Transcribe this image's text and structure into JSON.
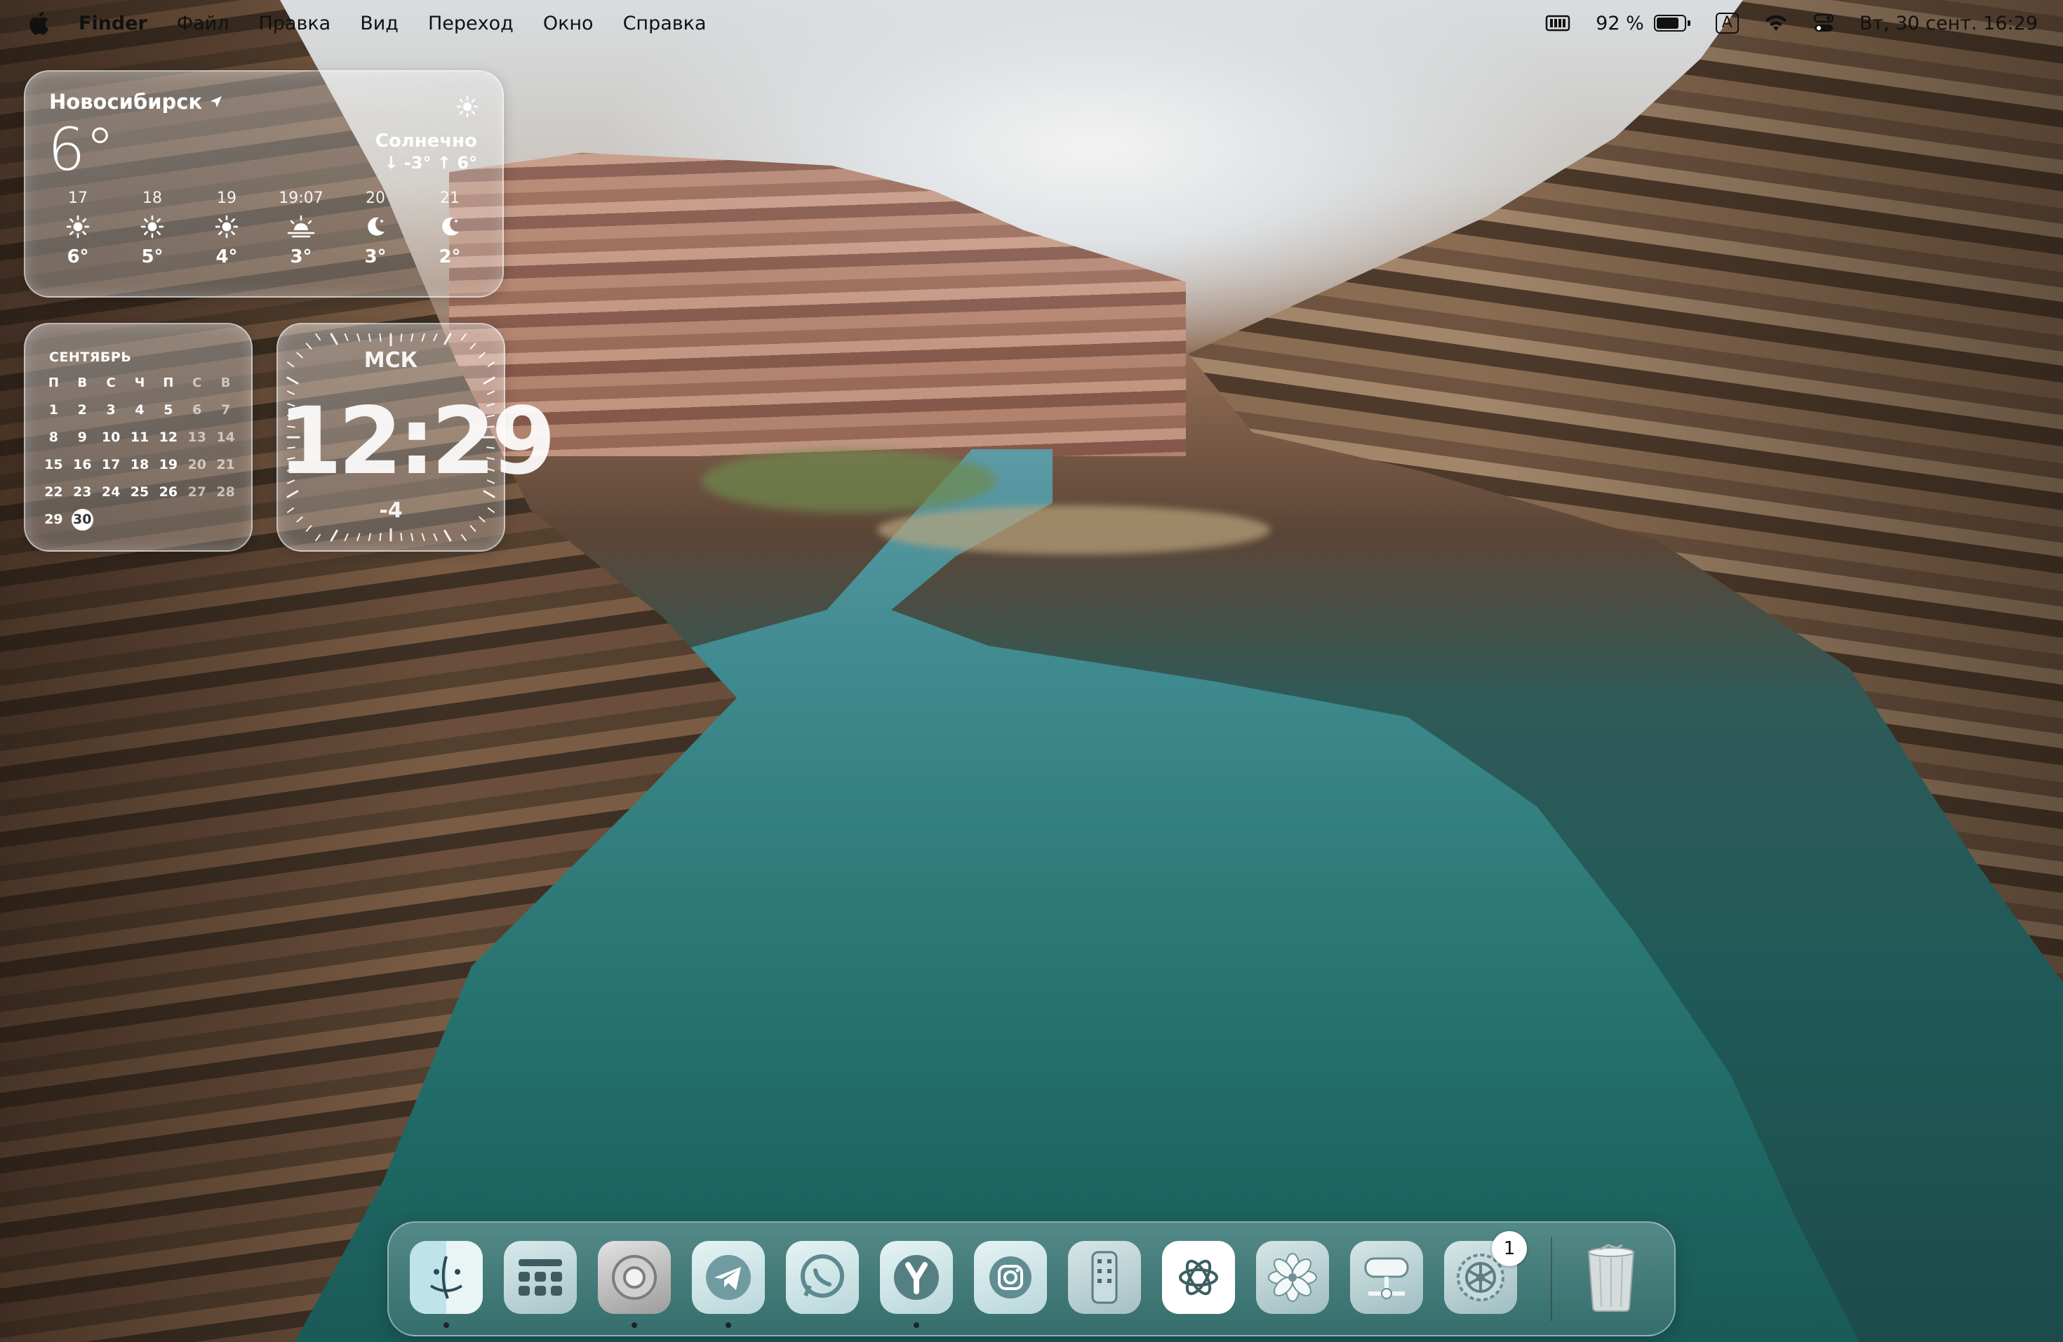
{
  "menubar": {
    "apple_icon": "apple-icon",
    "app_name": "Finder",
    "menus": [
      "Файл",
      "Правка",
      "Вид",
      "Переход",
      "Окно",
      "Справка"
    ],
    "battery_percent": "92 %",
    "battery_level": 0.92,
    "input_source": "A",
    "datetime": "Вт, 30 сент. 16:29"
  },
  "weather": {
    "city": "Новосибирск",
    "temperature": "6°",
    "condition": "Солнечно",
    "range": "↓ -3° ↑ 6°",
    "hours": [
      {
        "time": "17",
        "icon": "sun-icon",
        "temp": "6°"
      },
      {
        "time": "18",
        "icon": "sun-icon",
        "temp": "5°"
      },
      {
        "time": "19",
        "icon": "sun-icon",
        "temp": "4°"
      },
      {
        "time": "19:07",
        "icon": "sunset-icon",
        "temp": "3°"
      },
      {
        "time": "20",
        "icon": "moon-icon",
        "temp": "3°"
      },
      {
        "time": "21",
        "icon": "moon-icon",
        "temp": "2°"
      }
    ]
  },
  "calendar": {
    "month": "СЕНТЯБРЬ",
    "weekdays": [
      "П",
      "В",
      "С",
      "Ч",
      "П",
      "С",
      "В"
    ],
    "days": [
      "1",
      "2",
      "3",
      "4",
      "5",
      "6",
      "7",
      "8",
      "9",
      "10",
      "11",
      "12",
      "13",
      "14",
      "15",
      "16",
      "17",
      "18",
      "19",
      "20",
      "21",
      "22",
      "23",
      "24",
      "25",
      "26",
      "27",
      "28",
      "29",
      "30"
    ],
    "today": "30"
  },
  "clock": {
    "city": "МСК",
    "time": "12:29",
    "offset": "-4"
  },
  "dock": {
    "items": [
      {
        "name": "finder",
        "running": true
      },
      {
        "name": "launchpad",
        "running": false
      },
      {
        "name": "chrome",
        "running": true
      },
      {
        "name": "telegram",
        "running": true
      },
      {
        "name": "whatsapp",
        "running": false
      },
      {
        "name": "yandex-browser",
        "running": true
      },
      {
        "name": "instagram",
        "running": false
      },
      {
        "name": "remote",
        "running": false
      },
      {
        "name": "chatgpt",
        "running": false
      },
      {
        "name": "photos",
        "running": false
      },
      {
        "name": "network-drive",
        "running": false
      },
      {
        "name": "system-settings",
        "running": false,
        "badge": "1"
      },
      {
        "name": "trash",
        "running": false
      }
    ]
  }
}
